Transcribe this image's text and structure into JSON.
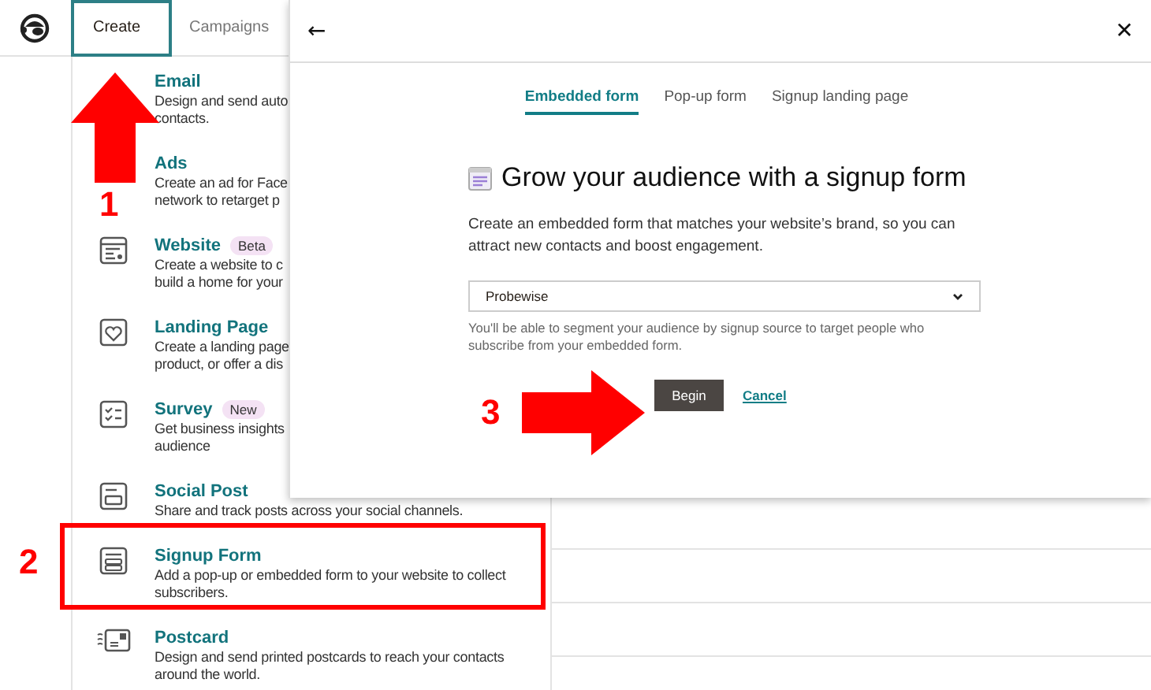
{
  "top_nav": {
    "create_label": "Create",
    "create_open": true,
    "campaigns_label": "Campaigns"
  },
  "create_menu": [
    {
      "title": "Email",
      "description": [
        "Design and send auto",
        "contacts."
      ]
    },
    {
      "title": "Ads",
      "description": [
        "Create an ad for Face",
        "network to retarget p"
      ]
    },
    {
      "kind": "website",
      "title": "Website",
      "badge": "Beta",
      "description": [
        "Create a website to c",
        "build a home for your"
      ]
    },
    {
      "kind": "landing_page",
      "title": "Landing Page",
      "description": [
        "Create a landing page",
        "product, or offer a dis"
      ]
    },
    {
      "kind": "survey",
      "title": "Survey",
      "badge": "New",
      "description": [
        "Get business insights",
        "audience"
      ]
    },
    {
      "kind": "social_post",
      "title": "Social Post",
      "description": [
        "Share and track posts across your social channels."
      ]
    },
    {
      "kind": "signup_form",
      "title": "Signup Form",
      "description": [
        "Add a pop-up or embedded form to your website to collect",
        "subscribers."
      ]
    },
    {
      "kind": "postcard",
      "title": "Postcard",
      "description": [
        "Design and send printed postcards to reach your contacts",
        "around the world."
      ]
    }
  ],
  "modal": {
    "back": "←",
    "close": "✕",
    "tabs": [
      {
        "label": "Embedded form",
        "selected": true
      },
      {
        "label": "Pop-up form",
        "selected": false
      },
      {
        "label": "Signup landing page",
        "selected": false
      }
    ],
    "title": "Grow your audience with a signup form",
    "description": "Create an embedded form that matches your website’s brand, so you can attract new contacts and boost engagement.",
    "audience_select": {
      "value": "Probewise"
    },
    "help_text": "You'll be able to segment your audience by signup source to target people who subscribe from your embedded form.",
    "begin_button": "Begin",
    "cancel_link": "Cancel"
  },
  "annotations": [
    {
      "kind": "up_arrow",
      "number": "1"
    },
    {
      "kind": "box",
      "number": "2"
    },
    {
      "kind": "right_arrow",
      "number": "3"
    }
  ]
}
